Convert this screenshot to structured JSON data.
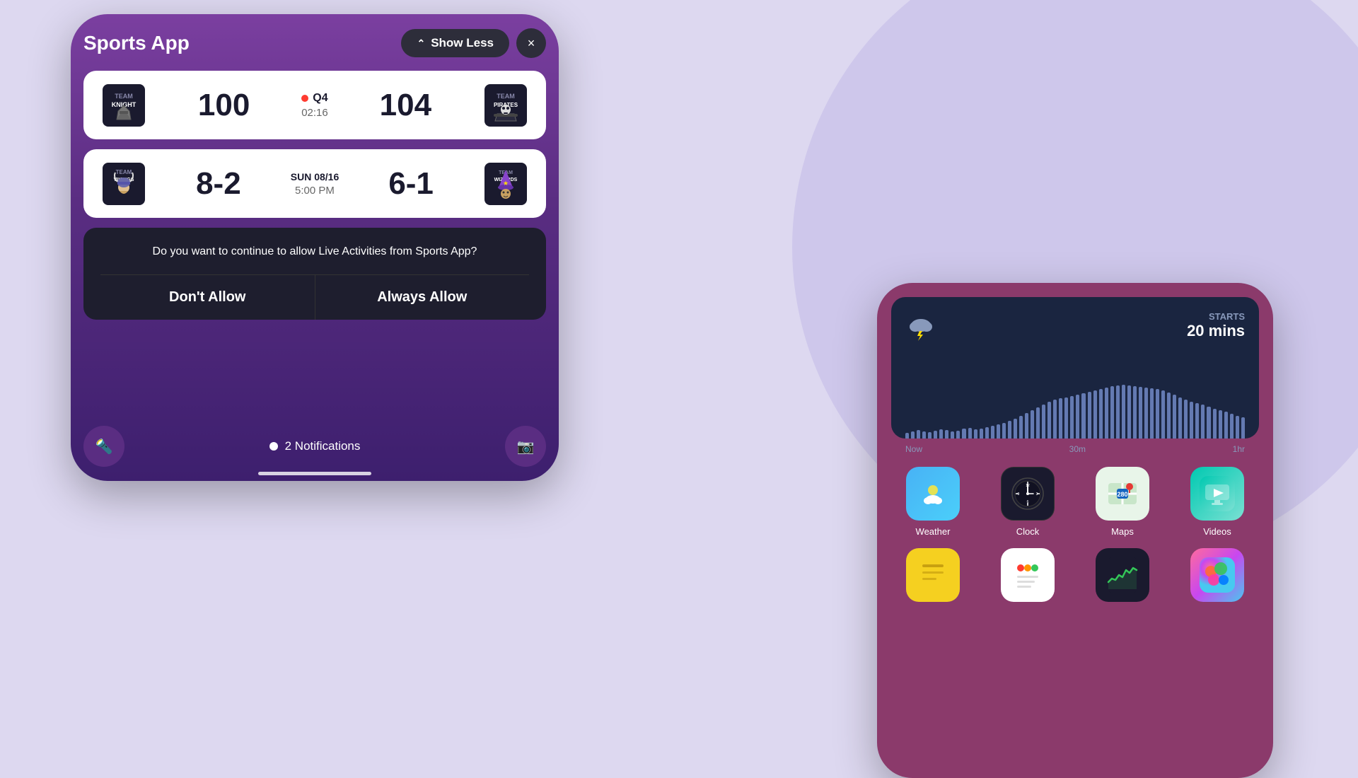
{
  "background": {
    "color": "#ddd8f0"
  },
  "left_phone": {
    "title": "Sports App",
    "show_less_label": "Show Less",
    "close_label": "×",
    "game1": {
      "team1_name": "Knight",
      "team1_score": "100",
      "team2_name": "Pirates",
      "team2_score": "104",
      "quarter": "Q4",
      "time": "02:16",
      "status": "live"
    },
    "game2": {
      "team1_name": "Vikings",
      "team1_score": "8-2",
      "team2_name": "Wizards",
      "team2_score": "6-1",
      "date": "SUN 08/16",
      "time": "5:00 PM"
    },
    "permission_text": "Do you want to continue to allow Live Activities from Sports App?",
    "dont_allow_label": "Don't Allow",
    "always_allow_label": "Always Allow",
    "notifications_text": "2 Notifications"
  },
  "right_phone": {
    "weather_widget": {
      "starts_label": "STARTS",
      "starts_time": "20 mins",
      "chart_labels": [
        "Now",
        "30m",
        "1hr"
      ]
    },
    "apps": [
      {
        "name": "Weather",
        "icon": "weather"
      },
      {
        "name": "Clock",
        "icon": "clock"
      },
      {
        "name": "Maps",
        "icon": "maps"
      },
      {
        "name": "Videos",
        "icon": "videos"
      },
      {
        "name": "",
        "icon": "notes-yellow"
      },
      {
        "name": "",
        "icon": "notes-white"
      },
      {
        "name": "",
        "icon": "stocks"
      },
      {
        "name": "",
        "icon": "games"
      }
    ]
  }
}
